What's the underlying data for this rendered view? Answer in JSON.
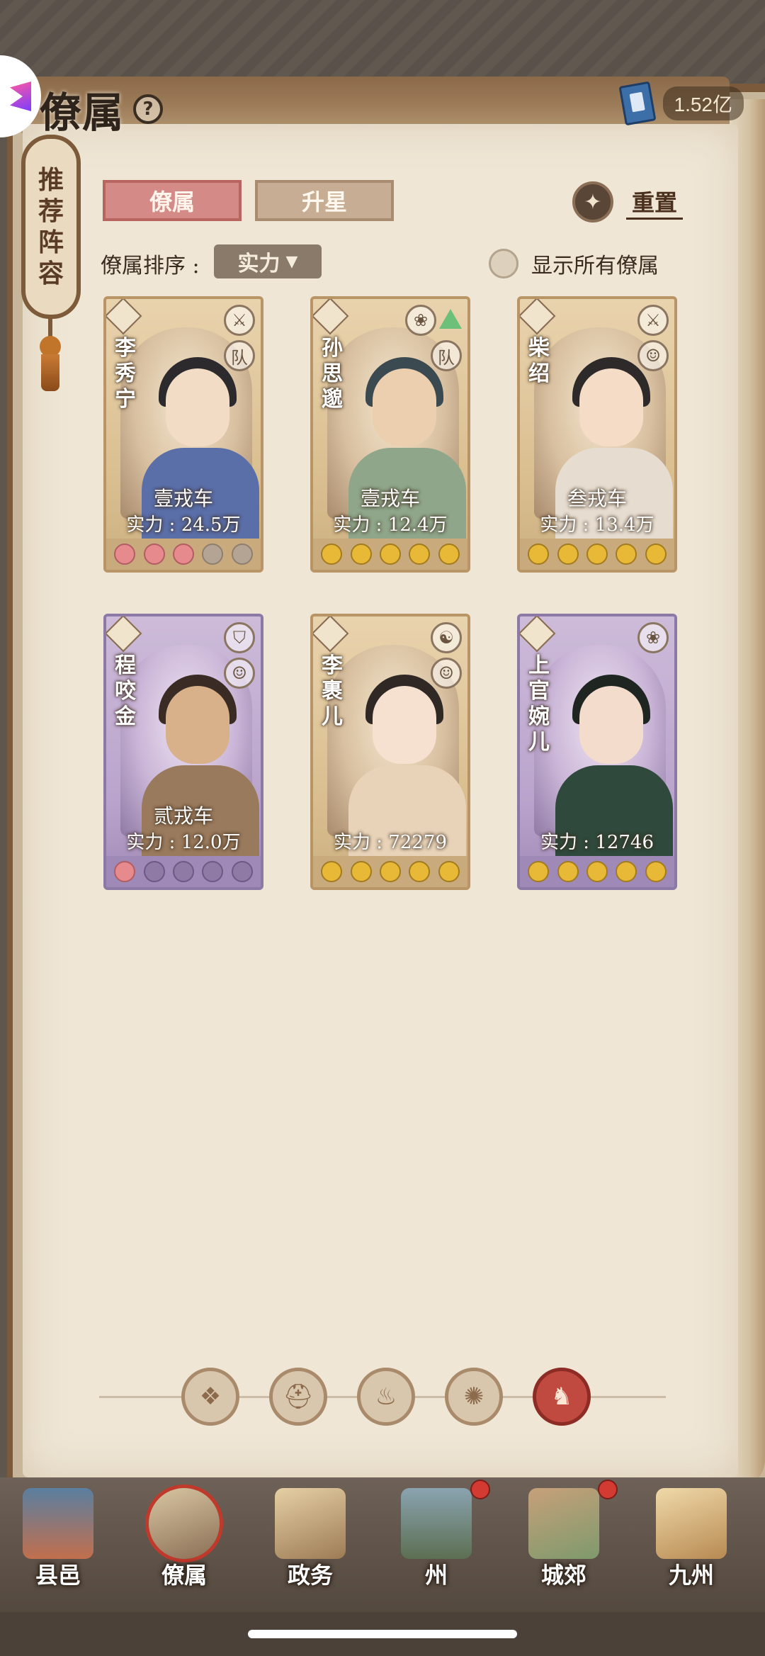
{
  "header": {
    "title": "僚属",
    "currency_value": "1.52亿"
  },
  "side_banner": {
    "chars": [
      "推",
      "荐",
      "阵",
      "容"
    ]
  },
  "tabs": [
    {
      "label": "僚属",
      "active": true
    },
    {
      "label": "升星",
      "active": false
    }
  ],
  "reset": {
    "label": "重置"
  },
  "sort": {
    "label": "僚属排序 :",
    "value": "实力"
  },
  "show_all": {
    "label": "显示所有僚属",
    "checked": false
  },
  "cards": [
    {
      "name": "李秀宁",
      "rank": "壹戎车",
      "power": "实力 : 24.5万",
      "frame": "gold",
      "stars": [
        "pink",
        "pink",
        "pink",
        "empty",
        "empty"
      ],
      "icons": [
        "sword-icon",
        "squad-icon"
      ]
    },
    {
      "name": "孙思邈",
      "rank": "壹戎车",
      "power": "实力 : 12.4万",
      "frame": "gold",
      "stars": [
        "gold",
        "gold",
        "gold",
        "gold",
        "gold"
      ],
      "icons": [
        "lotus-icon",
        "squad-icon"
      ],
      "upgrade": true
    },
    {
      "name": "柴绍",
      "rank": "叁戎车",
      "power": "实力 : 13.4万",
      "frame": "gold",
      "stars": [
        "gold",
        "gold",
        "gold",
        "gold",
        "gold"
      ],
      "icons": [
        "sword-icon",
        "portrait-icon"
      ]
    },
    {
      "name": "程咬金",
      "rank": "贰戎车",
      "power": "实力 : 12.0万",
      "frame": "violet",
      "stars": [
        "pink",
        "empty",
        "empty",
        "empty",
        "empty"
      ],
      "icons": [
        "shield-icon",
        "portrait-icon"
      ]
    },
    {
      "name": "李裹儿",
      "rank": "",
      "power": "实力 : 72279",
      "frame": "gold",
      "stars": [
        "gold",
        "gold",
        "gold",
        "gold",
        "gold"
      ],
      "icons": [
        "yinyang-icon",
        "portrait-icon"
      ]
    },
    {
      "name": "上官婉儿",
      "rank": "",
      "power": "实力 : 12746",
      "frame": "violet",
      "stars": [
        "gold",
        "gold",
        "gold",
        "gold",
        "gold"
      ],
      "icons": [
        "lotus-icon"
      ]
    }
  ],
  "filters": [
    {
      "icon": "diamond-icon",
      "active": false
    },
    {
      "icon": "helmet-icon",
      "active": false
    },
    {
      "icon": "gourd-icon",
      "active": false
    },
    {
      "icon": "fan-icon",
      "active": false
    },
    {
      "icon": "class-all-icon",
      "active": true
    }
  ],
  "nav": [
    {
      "label": "县邑",
      "badge": false,
      "active": false
    },
    {
      "label": "僚属",
      "badge": false,
      "active": true
    },
    {
      "label": "政务",
      "badge": false,
      "active": false
    },
    {
      "label": "州",
      "badge": true,
      "active": false
    },
    {
      "label": "城郊",
      "badge": true,
      "active": false
    },
    {
      "label": "九州",
      "badge": false,
      "active": false
    }
  ]
}
